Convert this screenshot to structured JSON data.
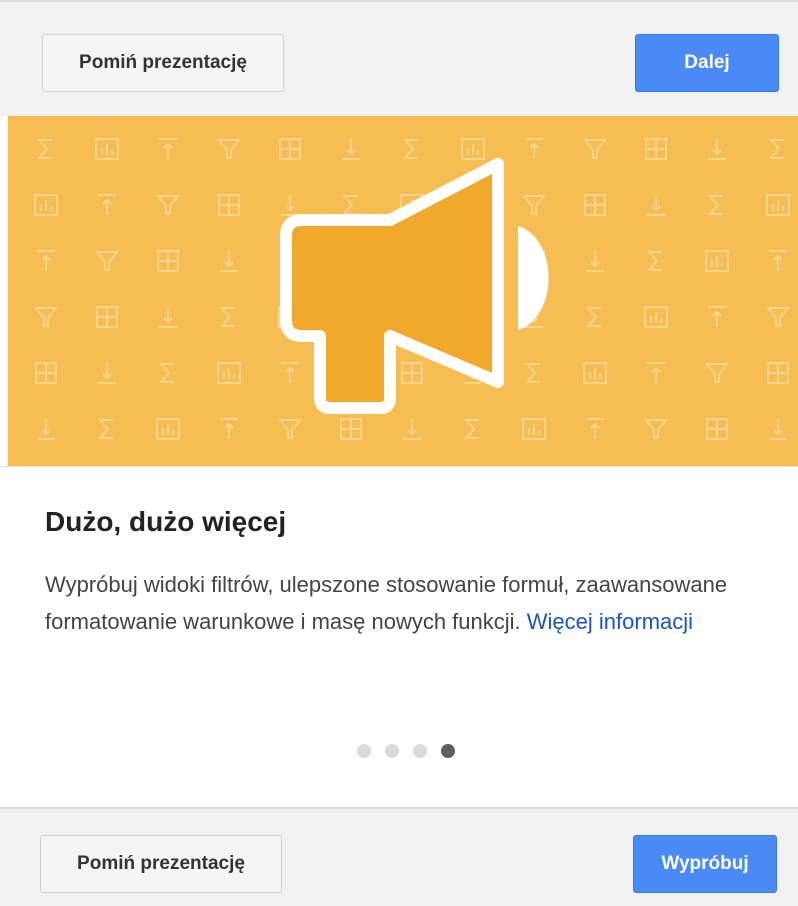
{
  "header": {
    "skip_label": "Pomiń prezentację",
    "next_label": "Dalej"
  },
  "slide": {
    "title": "Dużo, dużo więcej",
    "description": "Wypróbuj widoki filtrów, ulepszone stosowanie formuł, zaawansowane formatowanie warunkowe i masę nowych funkcji.",
    "link_label": "Więcej informacji",
    "hero_icon": "megaphone-icon",
    "background_pattern_icons": [
      "sum-icon",
      "chart-icon",
      "sort-up-icon",
      "filter-icon",
      "grid-icon",
      "sort-down-icon"
    ],
    "accent_color": "#f6bd52",
    "icon_fill_color": "#f0a92a"
  },
  "pagination": {
    "total": 4,
    "active_index": 3
  },
  "footer": {
    "skip_label": "Pomiń prezentację",
    "try_label": "Wypróbuj"
  },
  "colors": {
    "primary_button": "#4a8af4",
    "link": "#1a55c4"
  }
}
